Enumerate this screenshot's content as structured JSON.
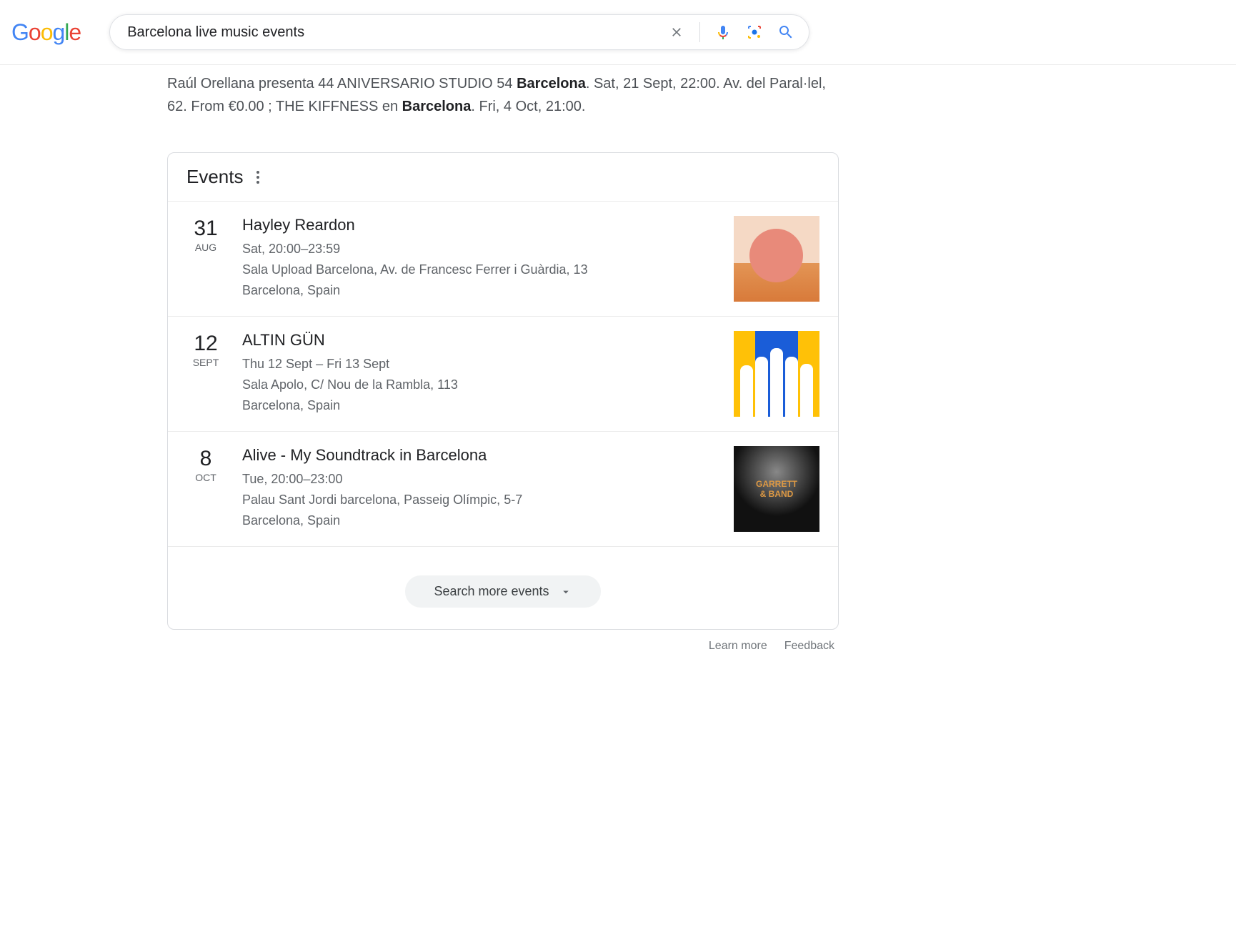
{
  "search": {
    "query": "Barcelona live music events"
  },
  "snippet": {
    "text_parts": [
      "Raúl Orellana presenta 44 ANIVERSARIO STUDIO 54 ",
      "Barcelona",
      ". Sat, 21 Sept, 22:00. Av. del Paral·lel, 62. From €0.00 ; THE KIFFNESS en ",
      "Barcelona",
      ". Fri, 4 Oct, 21:00."
    ]
  },
  "events_panel": {
    "title": "Events",
    "search_more_label": "Search more events",
    "events": [
      {
        "day": "31",
        "month": "AUG",
        "title": "Hayley Reardon",
        "time": "Sat, 20:00–23:59",
        "venue": "Sala Upload Barcelona, Av. de Francesc Ferrer i Guàrdia, 13",
        "location": "Barcelona, Spain"
      },
      {
        "day": "12",
        "month": "SEPT",
        "title": "ALTIN GÜN",
        "time": "Thu 12 Sept – Fri 13 Sept",
        "venue": "Sala Apolo, C/ Nou de la Rambla, 113",
        "location": "Barcelona, Spain"
      },
      {
        "day": "8",
        "month": "OCT",
        "title": "Alive - My Soundtrack in Barcelona",
        "time": "Tue, 20:00–23:00",
        "venue": "Palau Sant Jordi barcelona, Passeig Olímpic, 5-7",
        "location": "Barcelona, Spain"
      }
    ]
  },
  "footer": {
    "learn_more": "Learn more",
    "feedback": "Feedback"
  }
}
